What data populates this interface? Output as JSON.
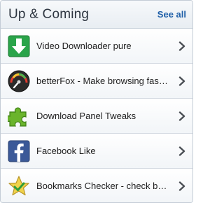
{
  "header": {
    "title": "Up & Coming",
    "see_all": "See all"
  },
  "items": [
    {
      "label": "Video Downloader pure",
      "icon": "download-arrow-icon"
    },
    {
      "label": "betterFox - Make browsing faster",
      "icon": "speedometer-icon"
    },
    {
      "label": "Download Panel Tweaks",
      "icon": "puzzle-piece-icon"
    },
    {
      "label": "Facebook Like",
      "icon": "facebook-icon"
    },
    {
      "label": "Bookmarks Checker - check bookmarks",
      "icon": "star-check-icon"
    }
  ],
  "colors": {
    "accent": "#1f5fa8",
    "download_green": "#2aa44a",
    "facebook_blue": "#3b5998",
    "puzzle_green": "#6ab42c",
    "star_yellow": "#f0d24a"
  }
}
